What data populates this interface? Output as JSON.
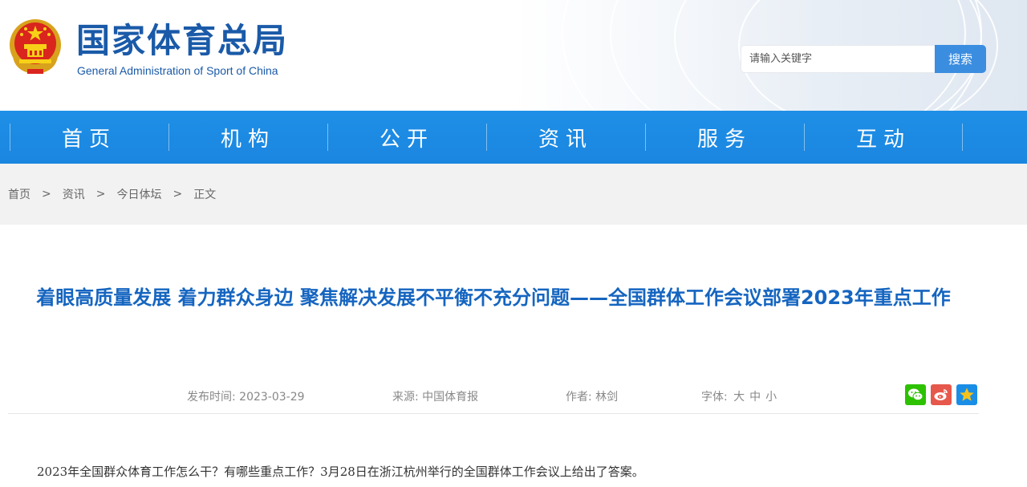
{
  "header": {
    "logo_cn": "国家体育总局",
    "logo_en": "General Administration of Sport of China",
    "emblem_icon": "national-emblem-icon"
  },
  "search": {
    "placeholder": "请输入关键字",
    "button_label": "搜索"
  },
  "nav": {
    "items": [
      "首页",
      "机构",
      "公开",
      "资讯",
      "服务",
      "互动"
    ]
  },
  "breadcrumb": {
    "items": [
      "首页",
      "资讯",
      "今日体坛",
      "正文"
    ],
    "separator": ">"
  },
  "article": {
    "title": "着眼高质量发展 着力群众身边 聚焦解决发展不平衡不充分问题——全国群体工作会议部署2023年重点工作",
    "publish_label": "发布时间:",
    "publish_date": "2023-03-29",
    "source_label": "来源:",
    "source": "中国体育报",
    "author_label": "作者:",
    "author": "林剑",
    "font_label": "字体:",
    "font_sizes": [
      "大",
      "中",
      "小"
    ],
    "first_paragraph": "2023年全国群众体育工作怎么干？有哪些重点工作？3月28日在浙江杭州举行的全国群体工作会议上给出了答案。"
  },
  "share": {
    "icons": [
      "wechat-icon",
      "weibo-icon",
      "qzone-icon"
    ]
  },
  "colors": {
    "brand_blue": "#1a5aa8",
    "nav_blue": "#1b86e0",
    "title_blue": "#1565c0",
    "search_button": "#3b8de0",
    "wechat": "#2dc100",
    "weibo": "#e6584b",
    "qzone": "#1a8ee6"
  }
}
